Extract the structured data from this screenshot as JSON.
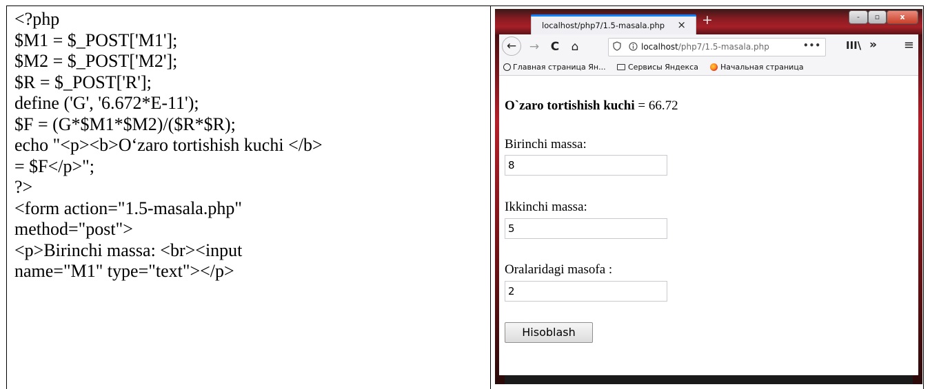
{
  "code": {
    "lines": [
      "<?php",
      "$M1 = $_POST['M1'];",
      "$M2 = $_POST['M2'];",
      "$R = $_POST['R'];",
      "define ('G', '6.672*E-11');",
      "$F = (G*$M1*$M2)/($R*$R);",
      "echo \"<p><b>O‘zaro tortishish kuchi </b>",
      "= $F</p>\";",
      "?>",
      "<form action=\"1.5-masala.php\"",
      "method=\"post\">",
      "<p>Birinchi massa: <br><input",
      "name=\"M1\" type=\"text\"></p>"
    ]
  },
  "browser": {
    "tab": {
      "title": "localhost/php7/1.5-masala.php",
      "close": "×"
    },
    "new_tab": "+",
    "window_controls": {
      "minimize": "-",
      "maximize": "▫",
      "close": "x"
    },
    "nav": {
      "back": "←",
      "forward": "→",
      "reload": "C",
      "home": "⌂",
      "url_host": "localhost",
      "url_path": "/php7/1.5-masala.php",
      "url_more": "•••",
      "library": "III\\",
      "overflow": "»",
      "menu": "≡"
    },
    "bookmarks": [
      {
        "label": "Главная страница Ян...",
        "icon": "globe-icon"
      },
      {
        "label": "Сервисы Яндекса",
        "icon": "folder-icon"
      },
      {
        "label": "Начальная страница",
        "icon": "firefox-icon"
      }
    ],
    "page": {
      "result_label": "O`zaro tortishish kuchi",
      "result_value": " = 66.72",
      "fields": [
        {
          "label": "Birinchi massa:",
          "value": "8"
        },
        {
          "label": "Ikkinchi massa:",
          "value": "5"
        },
        {
          "label": "Oralaridagi masofa :",
          "value": "2"
        }
      ],
      "submit_label": "Hisoblash"
    },
    "accent_color": "#0a84ff",
    "chrome_color": "#a61f27"
  }
}
